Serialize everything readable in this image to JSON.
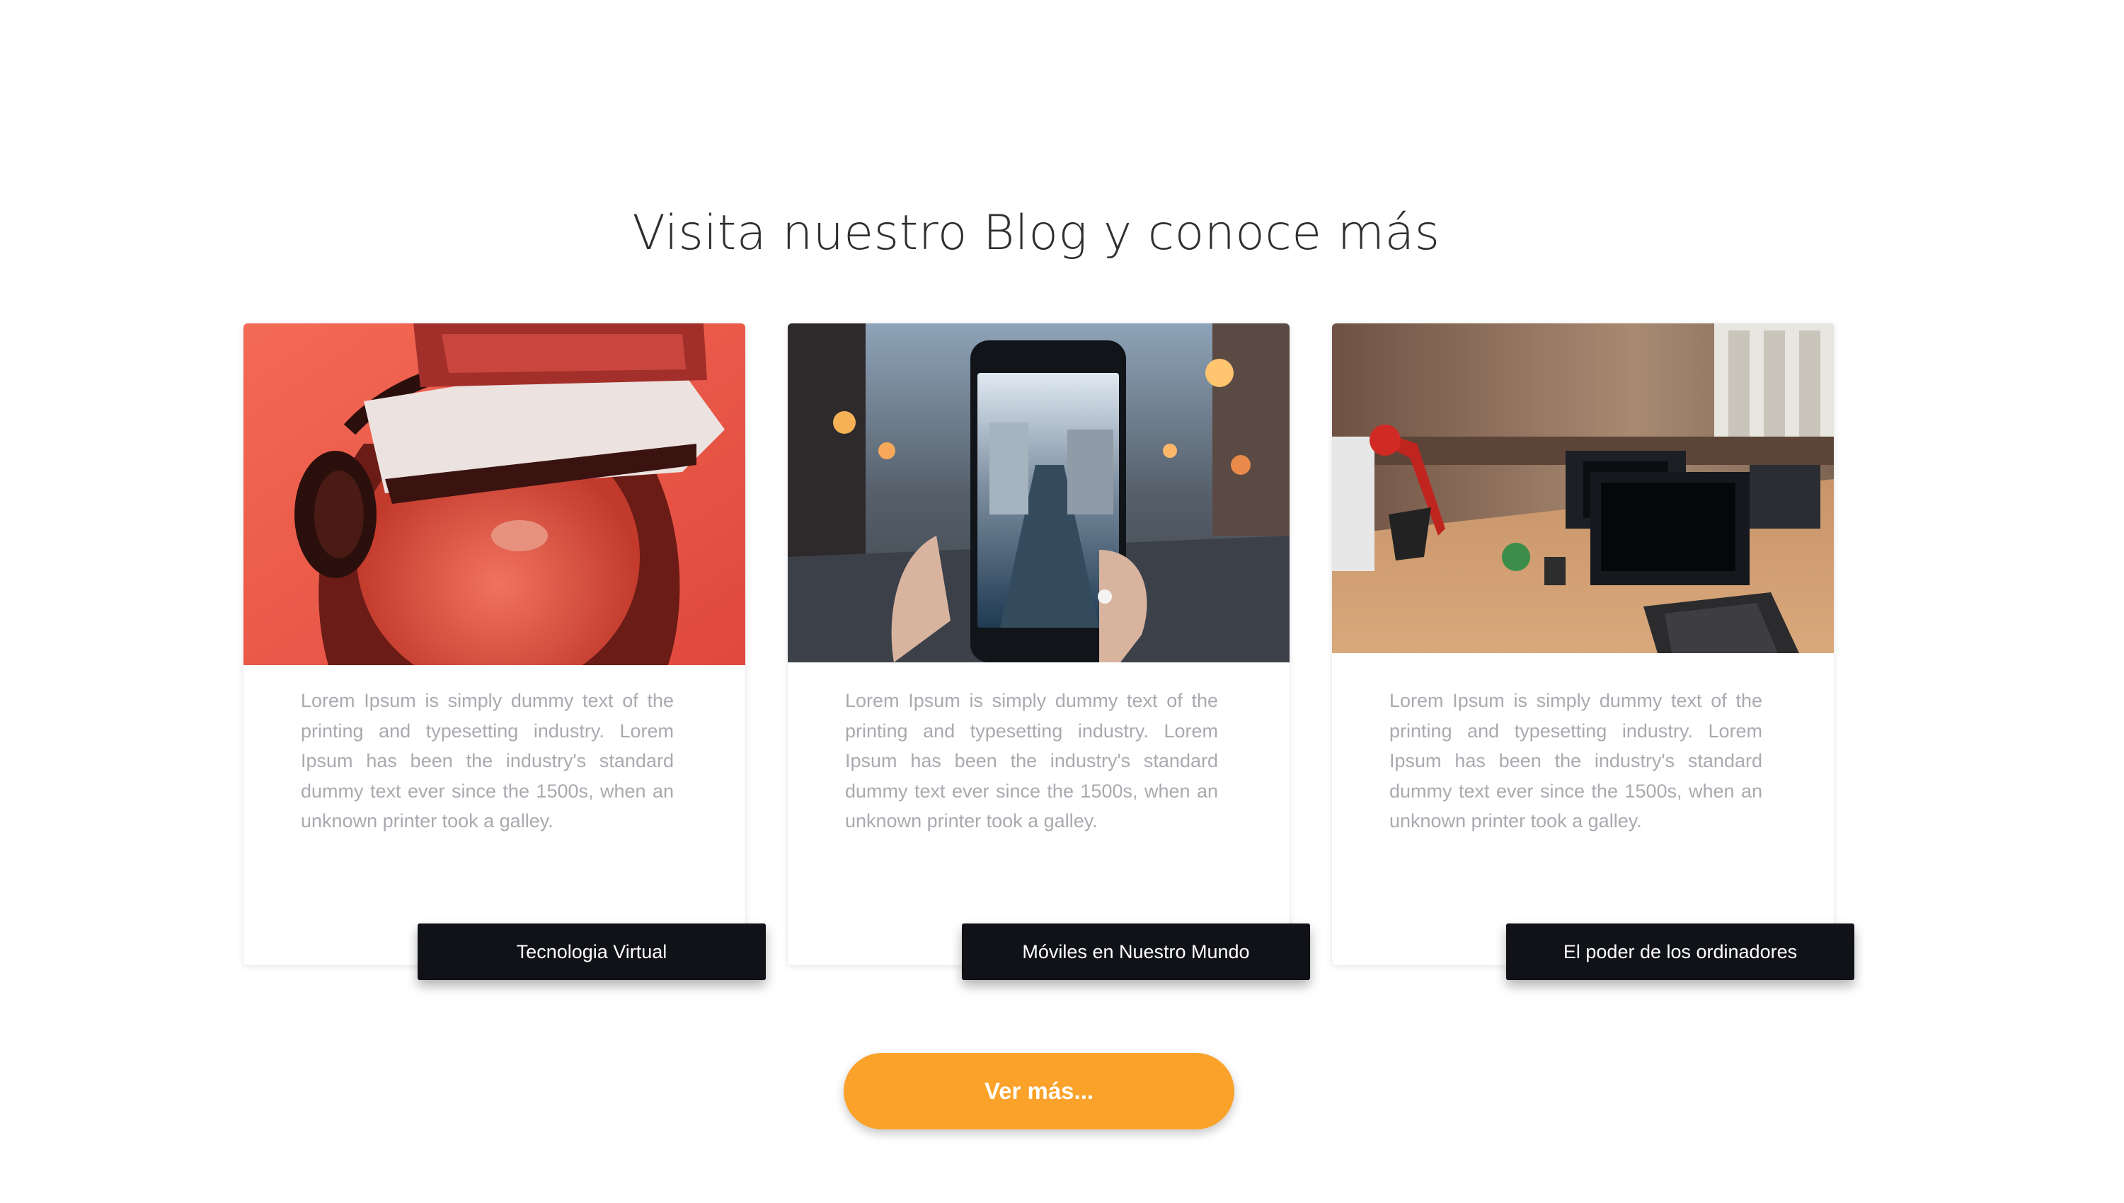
{
  "blog": {
    "title": "Visita nuestro Blog y conoce más",
    "cards": [
      {
        "image": "vr-headset-photo",
        "text": "Lorem Ipsum is simply dummy text of the printing and typesetting industry. Lorem Ipsum has been the industry's standard dummy text ever since the 1500s, when an unknown printer took a galley.",
        "tag": "Tecnologia Virtual"
      },
      {
        "image": "smartphone-street-photo",
        "text": "Lorem Ipsum is simply dummy text of the printing and typesetting industry. Lorem Ipsum has been the industry's standard dummy text ever since the 1500s, when an unknown printer took a galley.",
        "tag": "Móviles en Nuestro Mundo"
      },
      {
        "image": "office-computers-photo",
        "text": "Lorem Ipsum is simply dummy text of the printing and typesetting industry. Lorem Ipsum has been the industry's standard dummy text ever since the 1500s, when an unknown printer took a galley.",
        "tag": "El poder de los ordinadores"
      }
    ],
    "more_button": "Ver más..."
  },
  "colors": {
    "accent": "#fba22b",
    "tag_background": "#101218",
    "body_text": "#a9aaaf",
    "title_text": "#2f2f33"
  }
}
